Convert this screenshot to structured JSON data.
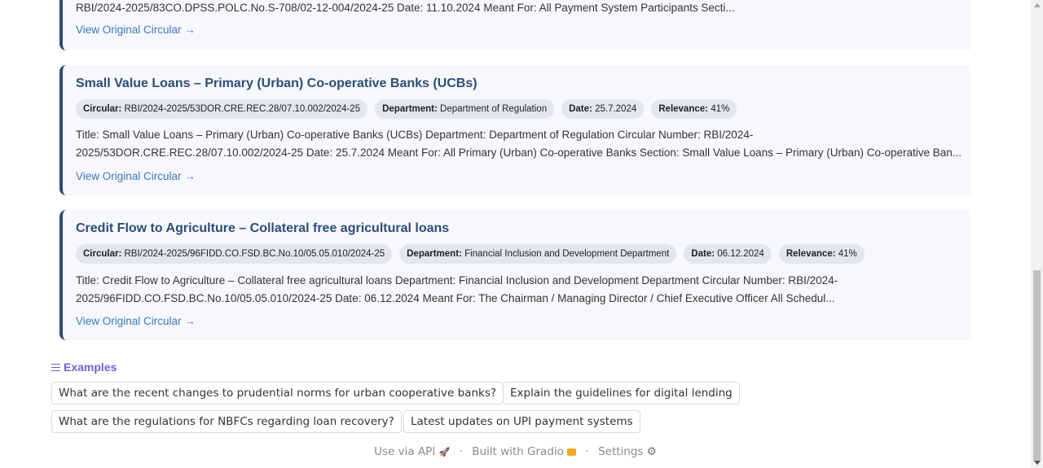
{
  "top_card": {
    "desc": "RBI/2024-2025/83CO.DPSS.POLC.No.S-708/02-12-004/2024-25 Date: 11.10.2024 Meant For: All Payment System Participants Secti...",
    "link": "View Original Circular →"
  },
  "cards": [
    {
      "title": "Small Value Loans – Primary (Urban) Co-operative Banks (UCBs)",
      "circular_label": "Circular:",
      "circular": "RBI/2024-2025/53DOR.CRE.REC.28/07.10.002/2024-25",
      "department_label": "Department:",
      "department": "Department of Regulation",
      "date_label": "Date:",
      "date": "25.7.2024",
      "relevance_label": "Relevance:",
      "relevance": "41%",
      "desc": "Title: Small Value Loans – Primary (Urban) Co-operative Banks (UCBs) Department: Department of Regulation Circular Number: RBI/2024-2025/53DOR.CRE.REC.28/07.10.002/2024-25 Date: 25.7.2024 Meant For: All Primary (Urban) Co-operative Banks Section: Small Value Loans – Primary (Urban) Co-operative Ban...",
      "link": "View Original Circular →"
    },
    {
      "title": "Credit Flow to Agriculture – Collateral free agricultural loans",
      "circular_label": "Circular:",
      "circular": "RBI/2024-2025/96FIDD.CO.FSD.BC.No.10/05.05.010/2024-25",
      "department_label": "Department:",
      "department": "Financial Inclusion and Development Department",
      "date_label": "Date:",
      "date": "06.12.2024",
      "relevance_label": "Relevance:",
      "relevance": "41%",
      "desc_line1": "Title: Credit Flow to Agriculture – Collateral free agricultural loans Department: Financial Inclusion and Development Department Circular Number: RBI/2024-",
      "desc_line2": "2025/96FIDD.CO.FSD.BC.No.10/05.05.010/2024-25 Date: 06.12.2024 Meant For: The Chairman / Managing Director / Chief Executive Officer All Schedul...",
      "link": "View Original Circular →"
    }
  ],
  "examples": {
    "heading": "Examples",
    "items": [
      "What are the recent changes to prudential norms for urban cooperative banks?",
      "Explain the guidelines for digital lending",
      "What are the regulations for NBFCs regarding loan recovery?",
      "Latest updates on UPI payment systems"
    ]
  },
  "footer": {
    "api": "Use via API",
    "api_icon": "🚀",
    "sep": "·",
    "built": "Built with Gradio",
    "built_icon": "🟠",
    "settings": "Settings",
    "settings_icon": "⚙"
  }
}
